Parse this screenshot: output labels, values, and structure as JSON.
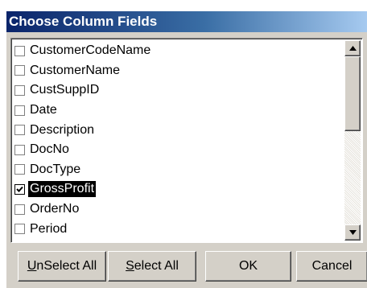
{
  "dialog": {
    "title": "Choose Column Fields"
  },
  "list": {
    "items": [
      {
        "label": "CustomerCodeName",
        "checked": false,
        "selected": false
      },
      {
        "label": "CustomerName",
        "checked": false,
        "selected": false
      },
      {
        "label": "CustSuppID",
        "checked": false,
        "selected": false
      },
      {
        "label": "Date",
        "checked": false,
        "selected": false
      },
      {
        "label": "Description",
        "checked": false,
        "selected": false
      },
      {
        "label": "DocNo",
        "checked": false,
        "selected": false
      },
      {
        "label": "DocType",
        "checked": false,
        "selected": false
      },
      {
        "label": "GrossProfit",
        "checked": true,
        "selected": true
      },
      {
        "label": "OrderNo",
        "checked": false,
        "selected": false
      },
      {
        "label": "Period",
        "checked": false,
        "selected": false
      }
    ]
  },
  "buttons": {
    "unselect_all": {
      "mnemonic": "U",
      "rest": "nSelect All"
    },
    "select_all": {
      "mnemonic": "S",
      "rest": "elect All"
    },
    "ok": "OK",
    "cancel": "Cancel"
  },
  "icons": {
    "scroll_up": "triangle-up",
    "scroll_down": "triangle-down",
    "check": "checkmark"
  },
  "colors": {
    "title_start": "#0a246a",
    "title_end": "#a6caf0",
    "face": "#d4d0c8",
    "selection": "#000000"
  }
}
